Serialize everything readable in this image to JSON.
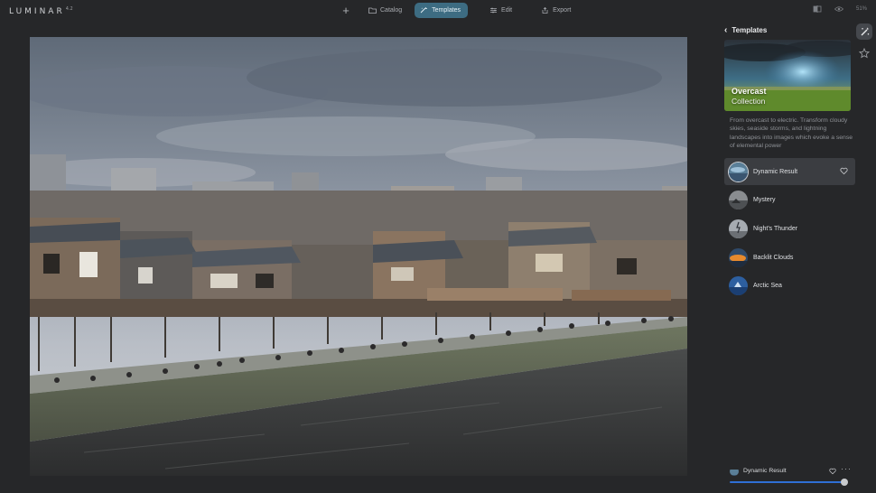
{
  "app": {
    "name": "LUMINAR",
    "version": "4.2"
  },
  "topbar": {
    "add_label": "+",
    "tabs": [
      {
        "label": "Catalog",
        "icon": "folder-icon",
        "active": false
      },
      {
        "label": "Templates",
        "icon": "magic-wand-icon",
        "active": true
      },
      {
        "label": "Edit",
        "icon": "sliders-icon",
        "active": false
      },
      {
        "label": "Export",
        "icon": "share-icon",
        "active": false
      }
    ],
    "zoom": "51%"
  },
  "panel": {
    "title": "Templates",
    "collection": {
      "title": "Overcast",
      "subtitle": "Collection",
      "description": "From overcast to electric. Transform cloudy skies, seaside storms, and lightning landscapes into images which evoke a sense of elemental power"
    },
    "templates": [
      {
        "label": "Dynamic Result",
        "selected": true
      },
      {
        "label": "Mystery",
        "selected": false
      },
      {
        "label": "Night's Thunder",
        "selected": false
      },
      {
        "label": "Backlit Clouds",
        "selected": false
      },
      {
        "label": "Arctic Sea",
        "selected": false
      }
    ],
    "active": {
      "label": "Dynamic Result",
      "more": "···",
      "amount": 1.0
    }
  },
  "colors": {
    "accent": "#3d6c82",
    "slider": "#2f6fd6",
    "background": "#262729"
  }
}
